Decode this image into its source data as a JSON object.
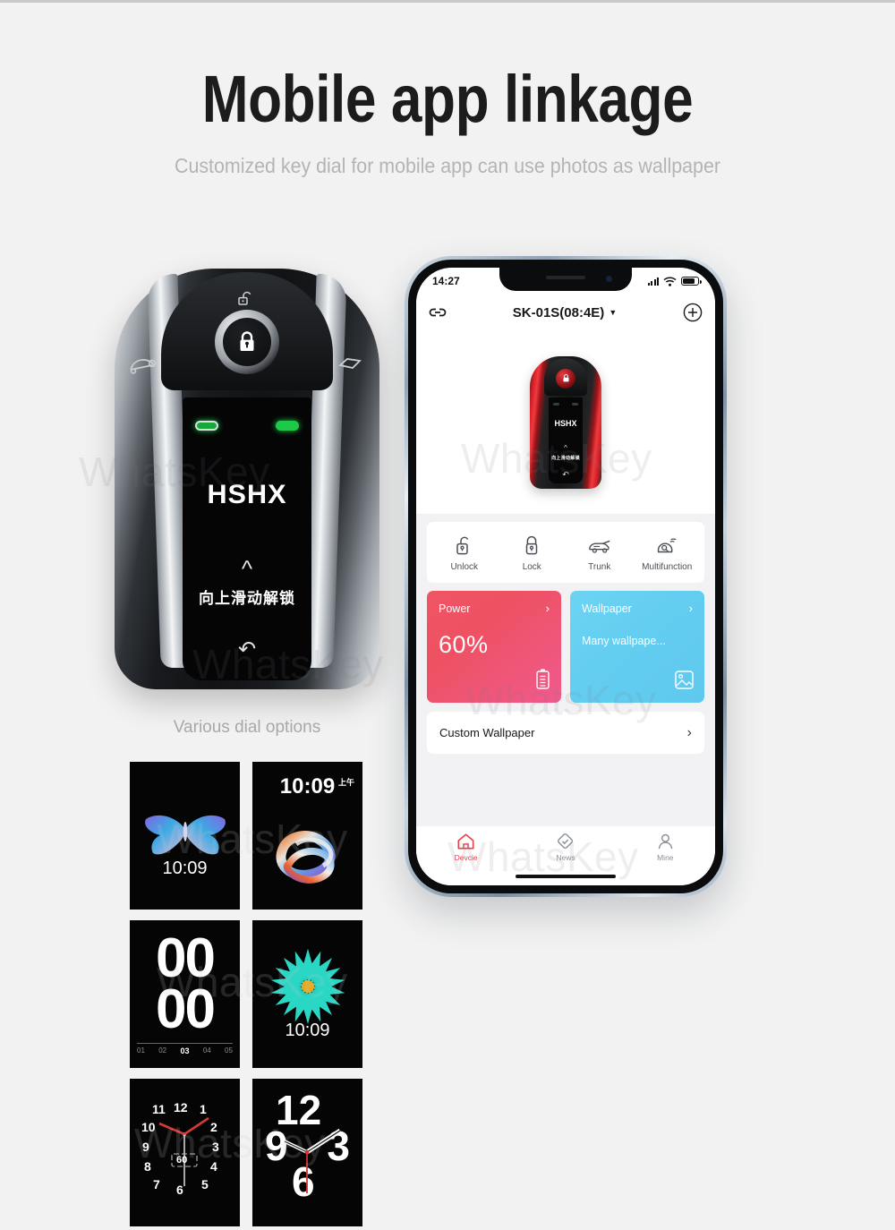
{
  "header": {
    "title": "Mobile app linkage",
    "subtitle": "Customized key dial for mobile app can use photos as wallpaper"
  },
  "watermark": {
    "text": "WhatsKey"
  },
  "keyfob": {
    "brand": "HSHX",
    "screen_hint": "向上滑动解锁",
    "chevron_icon": "chevron-up-icon",
    "back_icon": "back-arrow-icon",
    "lock_icon": "padlock-closed-icon",
    "unlock_icon": "padlock-open-icon",
    "car_icon": "car-icon",
    "trunk_icon": "trunk-icon",
    "caption": "Various dial options"
  },
  "dials": [
    {
      "name": "butterfly-dial",
      "art": "butterfly",
      "time": "10:09",
      "ampm": "",
      "time_pos": "bottom"
    },
    {
      "name": "swirl-dial",
      "art": "swirl",
      "time": "10:09",
      "ampm": "上午",
      "time_pos": "top"
    },
    {
      "name": "flip-digits-dial",
      "art": "digits",
      "digits_top": "00",
      "digits_bottom": "00",
      "scale": [
        "01",
        "02",
        "03",
        "04",
        "05"
      ],
      "scale_active": "03"
    },
    {
      "name": "flower-dial",
      "art": "flower",
      "time": "10:09",
      "ampm": "",
      "time_pos": "bottom"
    },
    {
      "name": "analog-numbers-dial",
      "art": "analog",
      "numbers": [
        "12",
        "1",
        "2",
        "3",
        "4",
        "5",
        "6",
        "7",
        "8",
        "9",
        "10",
        "11"
      ],
      "center_label": "60"
    },
    {
      "name": "big-quarters-dial",
      "art": "quarters",
      "numbers": [
        "12",
        "3",
        "6",
        "9"
      ]
    }
  ],
  "phone": {
    "statusbar": {
      "time": "14:27",
      "signal_icon": "signal-bars-icon",
      "wifi_icon": "wifi-icon",
      "battery_icon": "battery-icon"
    },
    "navbar": {
      "link_icon": "link-icon",
      "title": "SK-01S(08:4E)",
      "caret": "▼",
      "add_icon": "plus-circle-icon"
    },
    "device_image": {
      "brand": "HSHX",
      "hint": "向上滑动解锁"
    },
    "actions": [
      {
        "label": "Unlock",
        "icon": "padlock-open-icon"
      },
      {
        "label": "Lock",
        "icon": "padlock-closed-icon"
      },
      {
        "label": "Trunk",
        "icon": "car-trunk-icon"
      },
      {
        "label": "Multifunction",
        "icon": "car-signal-icon"
      }
    ],
    "tiles": [
      {
        "title": "Power",
        "value": "60%",
        "icon": "battery-vertical-icon",
        "chevron": "›",
        "color": "#ee5162"
      },
      {
        "title": "Wallpaper",
        "value": "Many wallpape...",
        "icon": "image-icon",
        "chevron": "›",
        "color": "#63cdf0"
      }
    ],
    "custom_row": {
      "label": "Custom Wallpaper",
      "chevron": "›"
    },
    "tabs": [
      {
        "label": "Devcie",
        "icon": "home-icon",
        "active": true
      },
      {
        "label": "News",
        "icon": "diamond-check-icon",
        "active": false
      },
      {
        "label": "Mine",
        "icon": "person-icon",
        "active": false
      }
    ]
  }
}
